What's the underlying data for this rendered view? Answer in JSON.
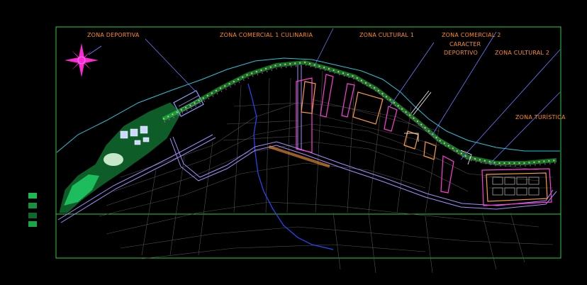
{
  "colors": {
    "background": "#000000",
    "frame": "#2ecc40",
    "label": "#ff8c1a",
    "leader": "#6b7cff",
    "coast": "#27c4d8",
    "river": "#2a48ff",
    "road": "#a78bff",
    "parcel_pink": "#ff3fd6",
    "parcel_orange": "#ff9a3a",
    "city_grid": "#6a6a6a",
    "green_area": "#1fcf5a",
    "compass": "#ff2ad4"
  },
  "zones": [
    {
      "id": "zona-deportiva",
      "label": "ZONA DEPORTIVA"
    },
    {
      "id": "zona-comercial-1",
      "label": "ZONA COMERCIAL 1 CULINARIA"
    },
    {
      "id": "zona-cultural-1",
      "label": "ZONA CULTURAL 1"
    },
    {
      "id": "zona-comercial-2",
      "label": "ZONA COMERCIAL 2"
    },
    {
      "id": "caracter",
      "label": "CARACTER"
    },
    {
      "id": "deportivo",
      "label": "DEPORTIVO"
    },
    {
      "id": "zona-cultural-2",
      "label": "ZONA CULTURAL 2"
    },
    {
      "id": "zona-turistica",
      "label": "ZONA TURÍSTICA"
    }
  ],
  "icons": {
    "compass": "north-arrow-compass-rose",
    "legend": "layer-legend-swatches"
  }
}
